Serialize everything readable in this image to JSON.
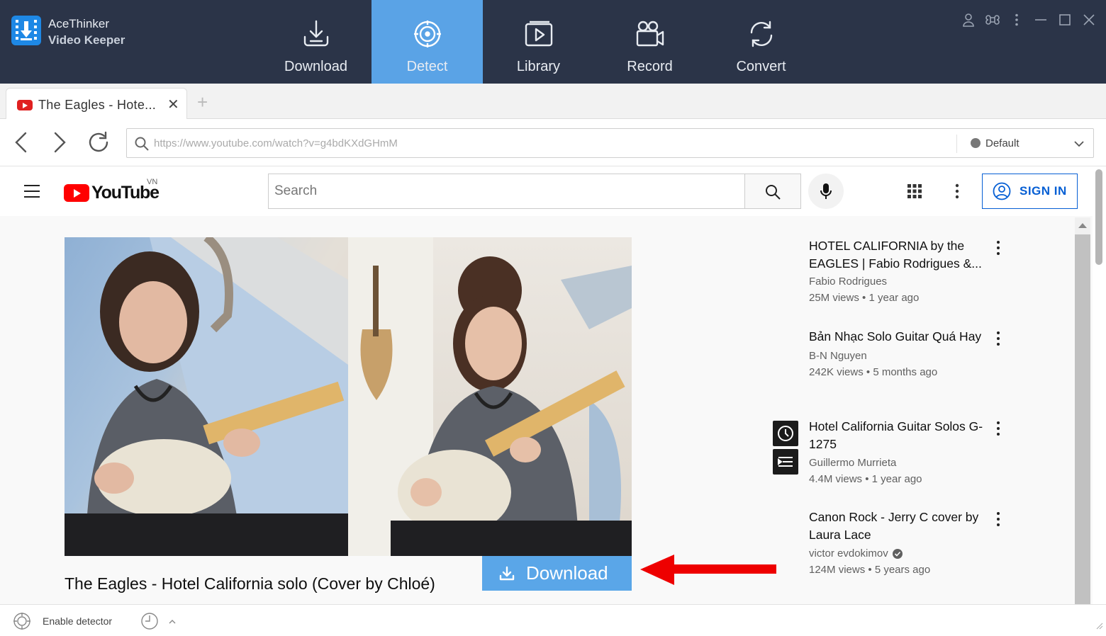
{
  "app": {
    "name_line1": "AceThinker",
    "name_line2": "Video Keeper",
    "nav": [
      {
        "label": "Download",
        "icon": "download-tray-icon",
        "active": false
      },
      {
        "label": "Detect",
        "icon": "detect-target-icon",
        "active": true
      },
      {
        "label": "Library",
        "icon": "library-play-icon",
        "active": false
      },
      {
        "label": "Record",
        "icon": "video-camera-icon",
        "active": false
      },
      {
        "label": "Convert",
        "icon": "convert-cycle-icon",
        "active": false
      }
    ],
    "window_controls": [
      "user-icon",
      "command-icon",
      "more-vertical-icon",
      "minimize-icon",
      "maximize-icon",
      "close-icon"
    ],
    "accent_color": "#5aa3e6",
    "topbar_color": "#2b3448"
  },
  "browser": {
    "tab": {
      "title": "The  Eagles  -  Hote...",
      "close": "✕"
    },
    "new_tab": "+",
    "url": "https://www.youtube.com/watch?v=g4bdKXdGHmM",
    "profile": "Default"
  },
  "youtube": {
    "logo_text": "YouTube",
    "country": "VN",
    "search_placeholder": "Search",
    "sign_in": "SIGN IN",
    "video_title": "The Eagles - Hotel California solo (Cover by Chloé)",
    "download_button": "Download",
    "related": [
      {
        "title": "HOTEL CALIFORNIA by the EAGLES | Fabio Rodrigues &...",
        "channel": "Fabio Rodrigues",
        "views": "25M views",
        "age": "1 year ago",
        "verified": false
      },
      {
        "title": "Bản Nhạc Solo Guitar Quá Hay",
        "channel": "B-N Nguyen",
        "views": "242K views",
        "age": "5 months ago",
        "verified": false
      },
      {
        "title": "Hotel California Guitar Solos G-1275",
        "channel": "Guillermo Murrieta",
        "views": "4.4M views",
        "age": "1 year ago",
        "verified": false
      },
      {
        "title": "Canon Rock - Jerry C cover by Laura Lace",
        "channel": "victor evdokimov",
        "views": "124M views",
        "age": "5 years ago",
        "verified": true
      }
    ],
    "meta_separator": "•"
  },
  "statusbar": {
    "enable_detector": "Enable detector"
  }
}
